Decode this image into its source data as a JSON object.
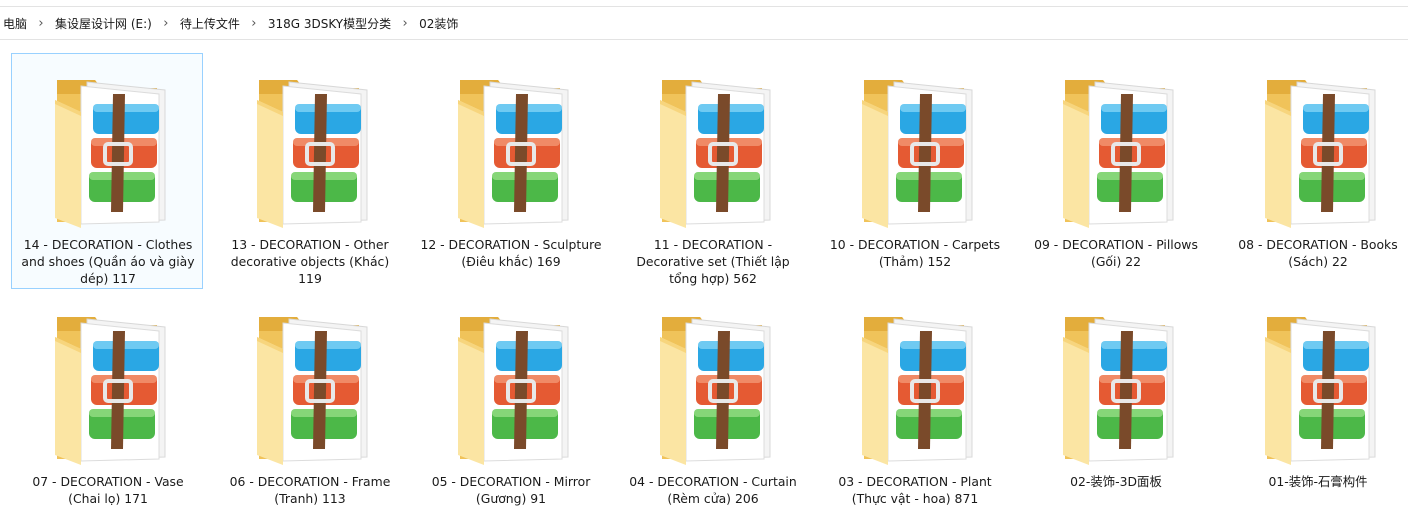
{
  "breadcrumb": [
    "电脑",
    "集设屋设计网 (E:)",
    "待上传文件",
    "318G 3DSKY模型分类",
    "02装饰"
  ],
  "folders": [
    {
      "label": "14 - DECORATION - Clothes and shoes (Quần áo và giày dép) 117",
      "selected": true
    },
    {
      "label": "13 - DECORATION - Other decorative objects (Khác) 119",
      "selected": false
    },
    {
      "label": "12 - DECORATION - Sculpture (Điêu khắc) 169",
      "selected": false
    },
    {
      "label": "11 - DECORATION - Decorative set (Thiết lập tổng hợp) 562",
      "selected": false
    },
    {
      "label": "10 - DECORATION - Carpets (Thảm) 152",
      "selected": false
    },
    {
      "label": "09 - DECORATION - Pillows (Gối) 22",
      "selected": false
    },
    {
      "label": "08 - DECORATION - Books (Sách) 22",
      "selected": false
    },
    {
      "label": "07 - DECORATION - Vase (Chai lọ) 171",
      "selected": false
    },
    {
      "label": "06 - DECORATION - Frame (Tranh) 113",
      "selected": false
    },
    {
      "label": "05 - DECORATION - Mirror (Gương) 91",
      "selected": false
    },
    {
      "label": "04 - DECORATION - Curtain (Rèm cửa) 206",
      "selected": false
    },
    {
      "label": "03 - DECORATION - Plant (Thực vật - hoa) 871",
      "selected": false
    },
    {
      "label": "02-装饰-3D面板",
      "selected": false
    },
    {
      "label": "01-装饰-石膏构件",
      "selected": false
    }
  ],
  "icon": "winrar-archive-folder-icon",
  "colors": {
    "selection_border": "#99d1ff",
    "folder_back": "#f0c35a",
    "folder_front": "#fbe5a3",
    "book_blue": "#2aa7e4",
    "book_red": "#e55a33",
    "book_green": "#4cb848",
    "strap": "#7a4a2a"
  }
}
